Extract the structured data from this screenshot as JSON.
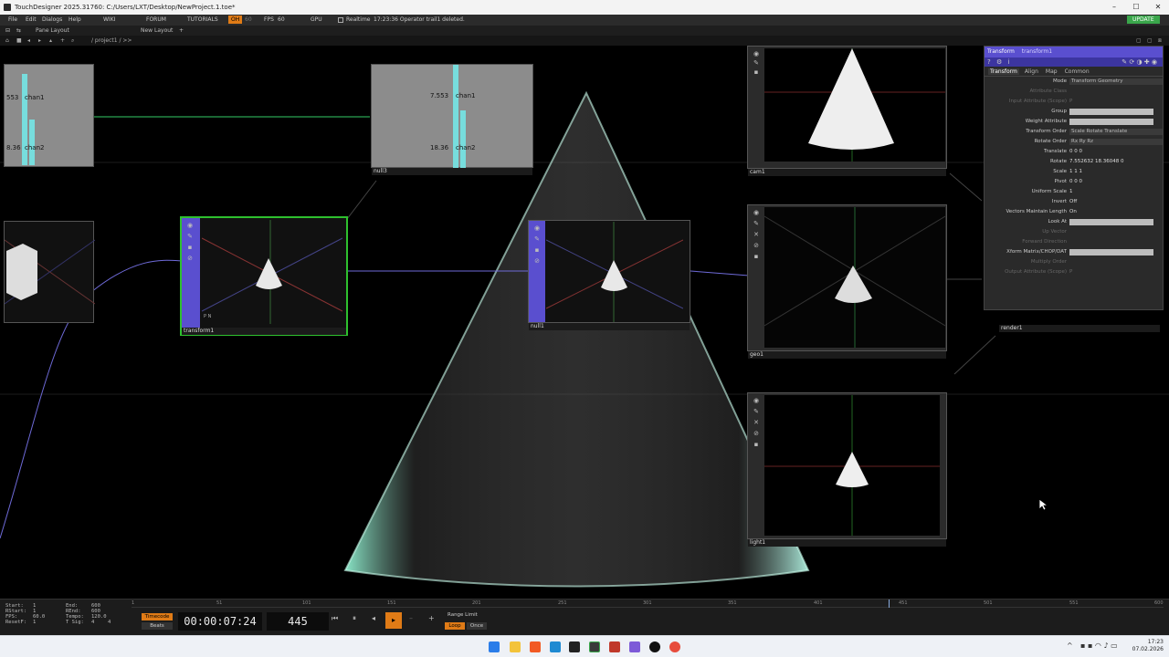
{
  "window": {
    "title": "TouchDesigner 2025.31760: C:/Users/LXT/Desktop/NewProject.1.toe*"
  },
  "menu": {
    "file": "File",
    "edit": "Edit",
    "dialogs": "Dialogs",
    "help": "Help",
    "wiki": "WIKI",
    "forum": "FORUM",
    "tutorials": "TUTORIALS",
    "oh": "OH",
    "oh_num": "60",
    "fps": "FPS",
    "fps_val": "60",
    "gpu": "GPU",
    "realtime": "Realtime",
    "status": "17:23:36 Operator trail1 deleted.",
    "update": "UPDATE"
  },
  "panebar": {
    "pane_layout": "Pane Layout",
    "new_layout": "New Layout",
    "add": "+"
  },
  "pathbar": {
    "path": "/ project1 / >>"
  },
  "nodes": {
    "chop_left": {
      "val1": "553",
      "name1": "chan1",
      "val2": "8.36",
      "name2": "chan2"
    },
    "null3": {
      "label": "null3",
      "val1": "7.553",
      "name1": "chan1",
      "val2": "18.36",
      "name2": "chan2"
    },
    "transform1": {
      "label": "transform1",
      "flags": "P N"
    },
    "null1": {
      "label": "null1"
    },
    "cam1": {
      "label": "cam1"
    },
    "geo1": {
      "label": "geo1"
    },
    "light1": {
      "label": "light1"
    },
    "render1": {
      "label": "render1"
    }
  },
  "params": {
    "header_type": "Transform",
    "header_name": "transform1",
    "tabs": [
      "Transform",
      "Align",
      "Map",
      "Common"
    ],
    "rows": [
      {
        "label": "Mode",
        "value": "Transform Geometry",
        "kind": "menu"
      },
      {
        "label": "Attribute Class",
        "value": "",
        "kind": "dim"
      },
      {
        "label": "Input Attribute (Scope)",
        "value": "P",
        "kind": "dim"
      },
      {
        "label": "Group",
        "value": "",
        "kind": "field"
      },
      {
        "label": "Weight Attribute",
        "value": "",
        "kind": "field"
      },
      {
        "label": "Transform Order",
        "value": "Scale Rotate Translate",
        "kind": "menu"
      },
      {
        "label": "Rotate Order",
        "value": "Rx Ry Rz",
        "kind": "menu"
      },
      {
        "label": "Translate",
        "value": "0          0          0",
        "kind": "text"
      },
      {
        "label": "Rotate",
        "value": "7.552632  18.36048  0",
        "kind": "text"
      },
      {
        "label": "Scale",
        "value": "1          1          1",
        "kind": "text"
      },
      {
        "label": "Pivot",
        "value": "0          0          0",
        "kind": "text"
      },
      {
        "label": "Uniform Scale",
        "value": "1",
        "kind": "text"
      },
      {
        "label": "Invert",
        "value": "Off",
        "kind": "text"
      },
      {
        "label": "Vectors Maintain Length",
        "value": "On",
        "kind": "text"
      },
      {
        "label": "Look At",
        "value": "",
        "kind": "field"
      },
      {
        "label": "Up Vector",
        "value": "",
        "kind": "dim"
      },
      {
        "label": "Forward Direction",
        "value": "",
        "kind": "dim"
      },
      {
        "label": "Xform Matrix/CHOP/DAT",
        "value": "",
        "kind": "field"
      },
      {
        "label": "Multiply Order",
        "value": "",
        "kind": "dim"
      },
      {
        "label": "Output Attribute (Scope)",
        "value": "P",
        "kind": "dim"
      }
    ]
  },
  "timeline": {
    "start_label": "Start:",
    "start": "1",
    "rstart_label": "RStart:",
    "rstart": "1",
    "fps_label": "FPS:",
    "fps": "60.0",
    "resetf_label": "ResetF:",
    "resetf": "1",
    "end_label": "End:",
    "end": "600",
    "rend_label": "REnd:",
    "rend": "600",
    "tempo_label": "Tempo:",
    "tempo": "120.0",
    "tsig_label": "T Sig:",
    "tsig_a": "4",
    "tsig_b": "4",
    "timecode": "Timecode",
    "beats": "Beats",
    "time": "00:00:07:24",
    "frame": "445",
    "range_limit": "Range Limit",
    "loop": "Loop",
    "once": "Once",
    "ticks": [
      "1",
      "51",
      "101",
      "151",
      "201",
      "251",
      "301",
      "351",
      "401",
      "451",
      "501",
      "551",
      "600"
    ],
    "playhead_fraction": 0.74
  },
  "taskbar": {
    "time": "17:23",
    "date": "07.02.2026"
  }
}
